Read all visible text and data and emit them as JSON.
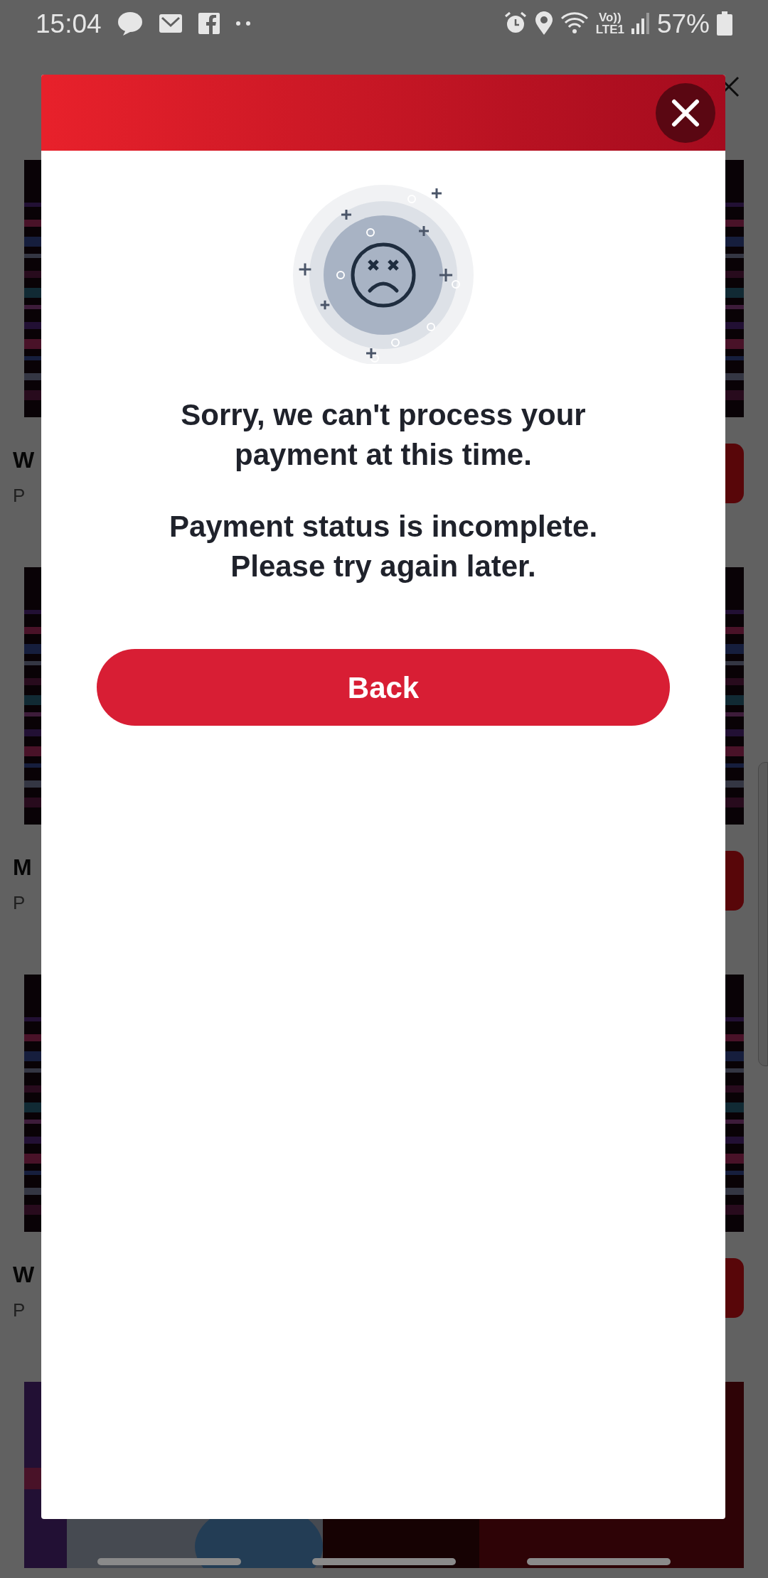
{
  "status_bar": {
    "time": "15:04",
    "volte": "Vo))",
    "lte": "LTE1",
    "battery": "57%"
  },
  "background": {
    "cards": [
      {
        "title": "W",
        "subtitle": "P",
        "kind": "item"
      },
      {
        "title": "M",
        "subtitle": "P",
        "kind": "item"
      },
      {
        "title": "W",
        "subtitle": "P",
        "kind": "item"
      },
      {
        "kind": "picture"
      }
    ]
  },
  "dialog": {
    "message_lines": [
      "Sorry, we can't process your",
      "payment at this time."
    ],
    "detail_lines": [
      "Payment status is incomplete.",
      "Please try again later."
    ],
    "button": "Back"
  }
}
